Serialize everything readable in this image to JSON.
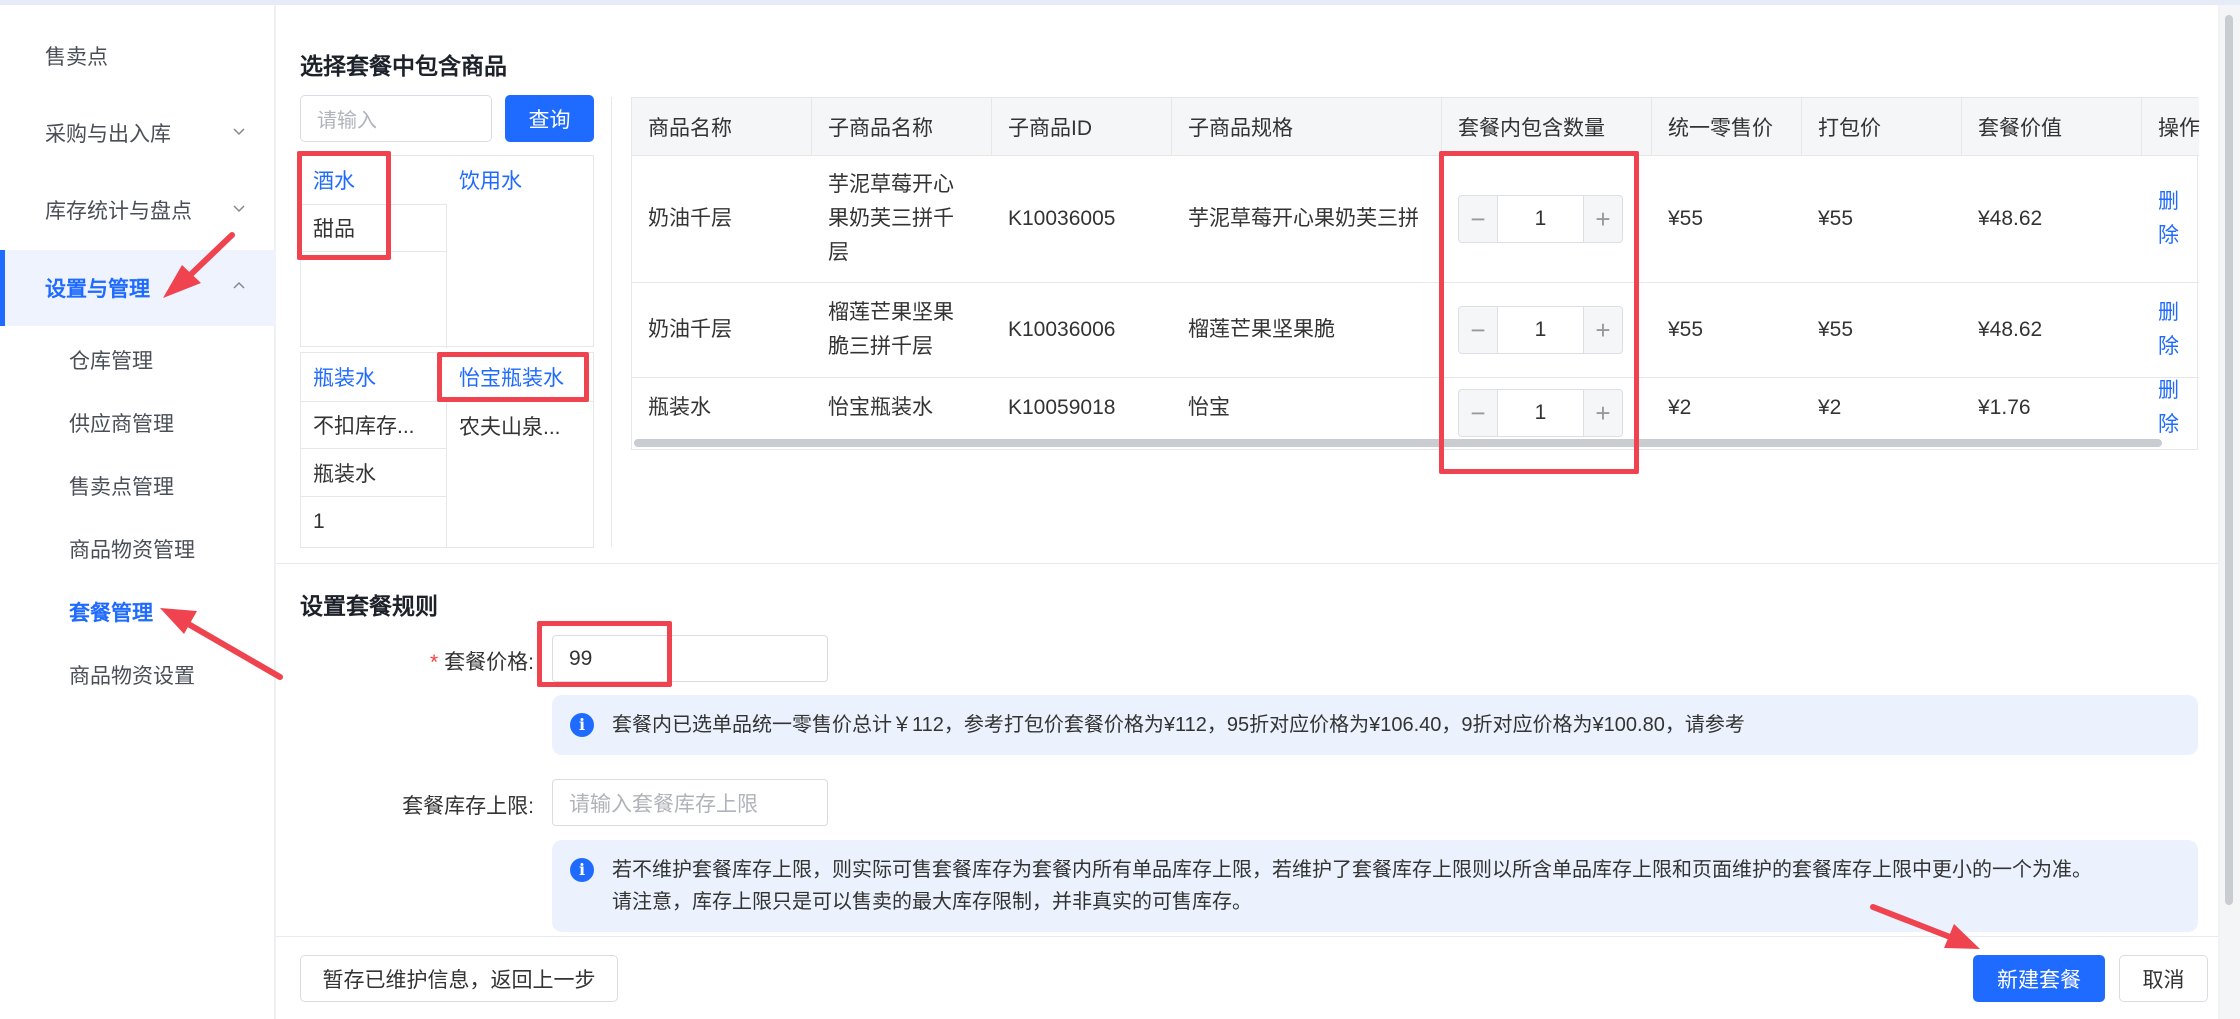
{
  "sidebar": {
    "items": [
      {
        "label": "售卖点"
      },
      {
        "label": "采购与出入库"
      },
      {
        "label": "库存统计与盘点"
      },
      {
        "label": "设置与管理"
      }
    ],
    "sub_items": [
      {
        "label": "仓库管理"
      },
      {
        "label": "供应商管理"
      },
      {
        "label": "售卖点管理"
      },
      {
        "label": "商品物资管理"
      },
      {
        "label": "套餐管理"
      },
      {
        "label": "商品物资设置"
      }
    ]
  },
  "select_section": {
    "title": "选择套餐中包含商品",
    "search_placeholder": "请输入",
    "search_button": "查询",
    "categories_top": {
      "col1_head": "酒水",
      "col2_head": "饮用水",
      "col1_item": "甜品"
    },
    "categories_bottom": {
      "col1_head": "瓶装水",
      "col2_head": "怡宝瓶装水",
      "col1_items": [
        "不扣库存...",
        "瓶装水",
        "1"
      ],
      "col2_items": [
        "农夫山泉..."
      ]
    }
  },
  "table": {
    "columns": [
      "商品名称",
      "子商品名称",
      "子商品ID",
      "子商品规格",
      "套餐内包含数量",
      "统一零售价",
      "打包价",
      "套餐价值",
      "操作"
    ],
    "rows": [
      {
        "name": "奶油千层",
        "sub_name": "芋泥草莓开心果奶芙三拼千层",
        "sub_id": "K10036005",
        "spec": "芋泥草莓开心果奶芙三拼",
        "qty": "1",
        "retail": "¥55",
        "pack": "¥55",
        "value": "¥48.62",
        "action": "删除"
      },
      {
        "name": "奶油千层",
        "sub_name": "榴莲芒果坚果脆三拼千层",
        "sub_id": "K10036006",
        "spec": "榴莲芒果坚果脆",
        "qty": "1",
        "retail": "¥55",
        "pack": "¥55",
        "value": "¥48.62",
        "action": "删除"
      },
      {
        "name": "瓶装水",
        "sub_name": "怡宝瓶装水",
        "sub_id": "K10059018",
        "spec": "怡宝",
        "qty": "1",
        "retail": "¥2",
        "pack": "¥2",
        "value": "¥1.76",
        "action": "删除"
      }
    ]
  },
  "rules_section": {
    "title": "设置套餐规则",
    "price_label": "套餐价格:",
    "price_required_mark": "*",
    "price_value": "99",
    "price_info": "套餐内已选单品统一零售价总计￥112，参考打包价套餐价格为¥112，95折对应价格为¥106.40，9折对应价格为¥100.80，请参考",
    "stock_label": "套餐库存上限:",
    "stock_placeholder": "请输入套餐库存上限",
    "stock_info_line1": "若不维护套餐库存上限，则实际可售套餐库存为套餐内所有单品库存上限，若维护了套餐库存上限则以所含单品库存上限和页面维护的套餐库存上限中更小的一个为准。",
    "stock_info_line2": "请注意，库存上限只是可以售卖的最大库存限制，并非真实的可售库存。"
  },
  "footer": {
    "save_draft": "暂存已维护信息，返回上一步",
    "create": "新建套餐",
    "cancel": "取消"
  },
  "colors": {
    "accent": "#1f6bff",
    "annotation": "#ef4350",
    "info_bg": "#ebf2fd"
  }
}
